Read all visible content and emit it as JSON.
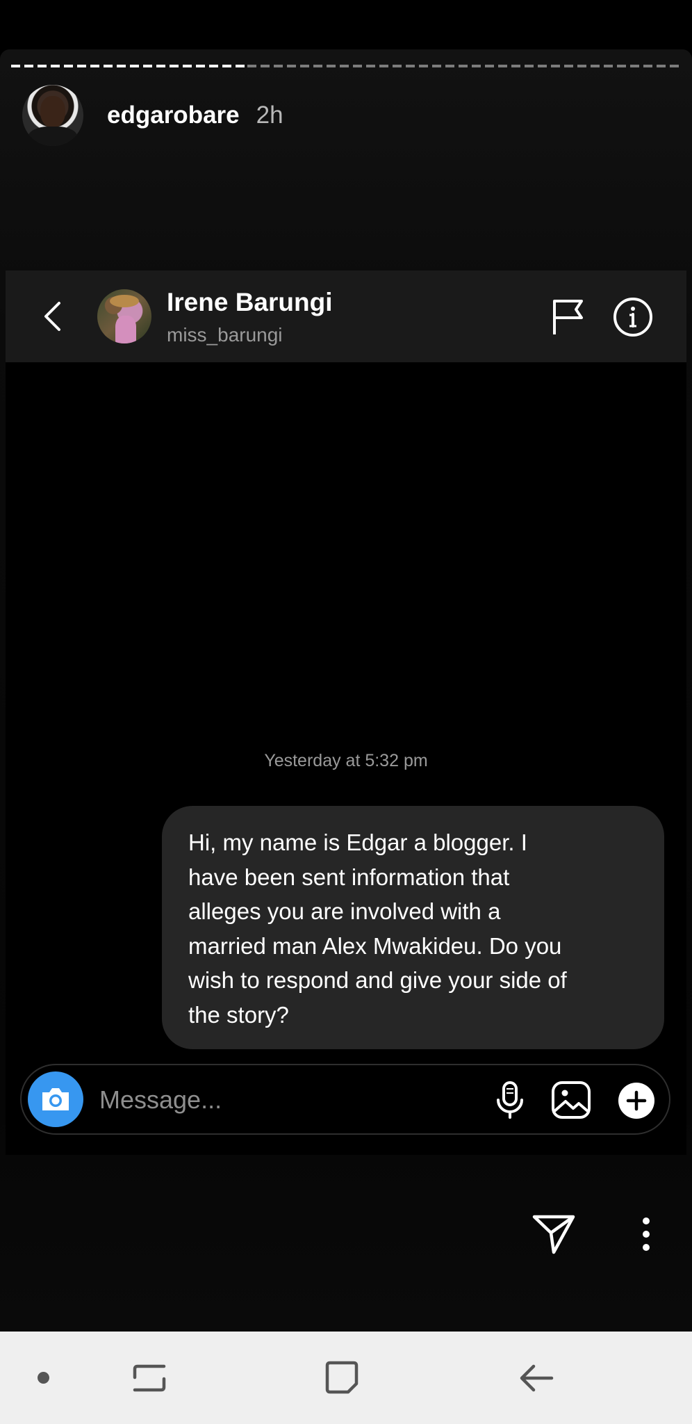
{
  "story": {
    "username": "edgarobare",
    "time_ago": "2h"
  },
  "dm": {
    "contact_name": "Irene Barungi",
    "contact_handle": "miss_barungi",
    "timestamp": "Yesterday at 5:32 pm",
    "messages": [
      {
        "direction": "outgoing",
        "lines": [
          "Hi, my name is Edgar a blogger. I",
          "have been sent information that",
          "alleges you are involved with a",
          "married man Alex Mwakideu. Do you",
          "wish to respond and give your side of",
          "the story?"
        ]
      }
    ],
    "composer": {
      "placeholder": "Message..."
    },
    "accent_color": "#3797f0",
    "bubble_color": "#262626"
  },
  "icons": {
    "header": [
      "back-arrow-icon",
      "flag-icon",
      "info-icon"
    ],
    "composer": [
      "camera-icon",
      "microphone-icon",
      "gallery-icon",
      "plus-icon"
    ],
    "story_footer": [
      "send-icon",
      "more-options-icon"
    ],
    "navbar": [
      "nav-dot-icon",
      "recents-icon",
      "home-icon",
      "back-icon"
    ]
  }
}
